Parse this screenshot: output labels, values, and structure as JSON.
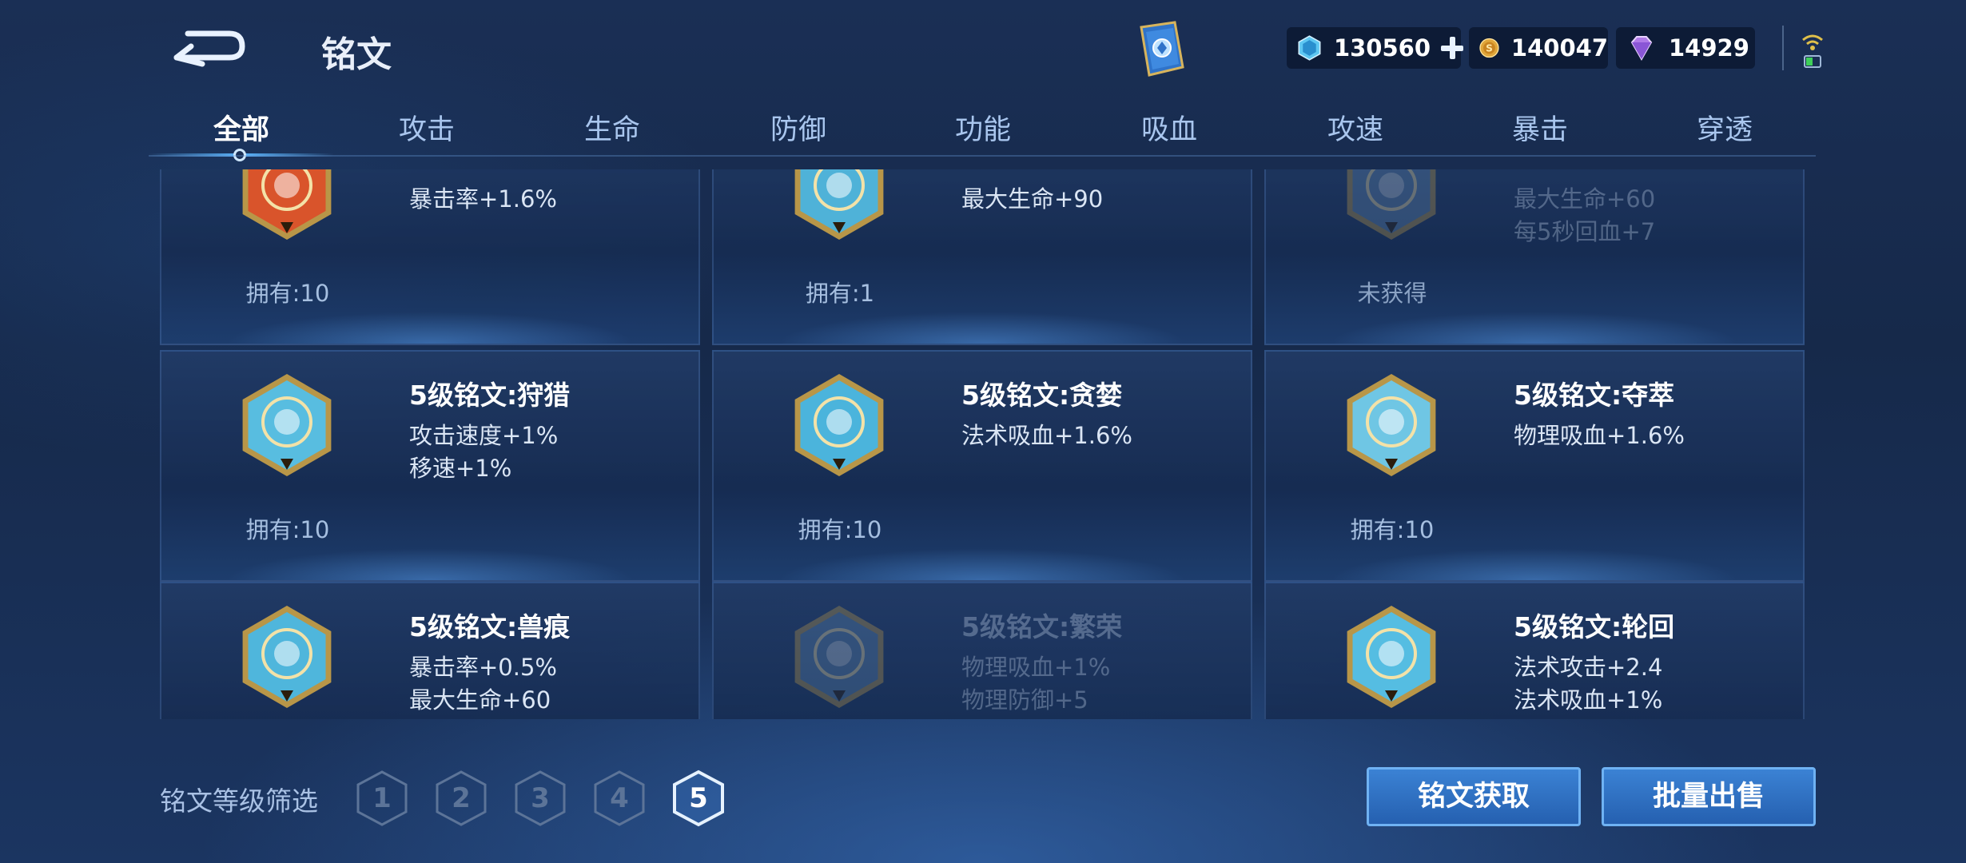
{
  "header": {
    "title": "铭文",
    "currencies": [
      {
        "icon": "gem-icon",
        "value": "130560"
      },
      {
        "icon": "gold-coin-icon",
        "value": "140047"
      },
      {
        "icon": "diamond-icon",
        "value": "14929"
      }
    ]
  },
  "tabs": [
    {
      "label": "全部",
      "active": true
    },
    {
      "label": "攻击"
    },
    {
      "label": "生命"
    },
    {
      "label": "防御"
    },
    {
      "label": "功能"
    },
    {
      "label": "吸血"
    },
    {
      "label": "攻速"
    },
    {
      "label": "暴击"
    },
    {
      "label": "穿透"
    }
  ],
  "cards": [
    {
      "name": "",
      "stat1": "暴击率+1.6%",
      "stat2": "",
      "owned": "拥有:10",
      "color": "#d9542b",
      "locked": false
    },
    {
      "name": "",
      "stat1": "最大生命+90",
      "stat2": "",
      "owned": "拥有:1",
      "color": "#4fb2d8",
      "locked": false
    },
    {
      "name": "",
      "stat1": "最大生命+60",
      "stat2": "每5秒回血+7",
      "owned": "未获得",
      "color": "#5f86b0",
      "locked": true
    },
    {
      "name": "5级铭文:狩猎",
      "stat1": "攻击速度+1%",
      "stat2": "移速+1%",
      "owned": "拥有:10",
      "color": "#58bde0",
      "locked": false
    },
    {
      "name": "5级铭文:贪婪",
      "stat1": "法术吸血+1.6%",
      "stat2": "",
      "owned": "拥有:10",
      "color": "#4bb4dc",
      "locked": false
    },
    {
      "name": "5级铭文:夺萃",
      "stat1": "物理吸血+1.6%",
      "stat2": "",
      "owned": "拥有:10",
      "color": "#6fc6e4",
      "locked": false
    },
    {
      "name": "5级铭文:兽痕",
      "stat1": "暴击率+0.5%",
      "stat2": "最大生命+60",
      "owned": "",
      "color": "#4fb6dc",
      "locked": false
    },
    {
      "name": "5级铭文:繁荣",
      "stat1": "物理吸血+1%",
      "stat2": "物理防御+5",
      "owned": "",
      "color": "#5b84ae",
      "locked": true
    },
    {
      "name": "5级铭文:轮回",
      "stat1": "法术攻击+2.4",
      "stat2": "法术吸血+1%",
      "owned": "",
      "color": "#55bde2",
      "locked": false
    }
  ],
  "footer": {
    "filter_label": "铭文等级筛选",
    "levels": [
      "1",
      "2",
      "3",
      "4",
      "5"
    ],
    "active_level": "5",
    "get_button": "铭文获取",
    "sell_button": "批量出售"
  }
}
